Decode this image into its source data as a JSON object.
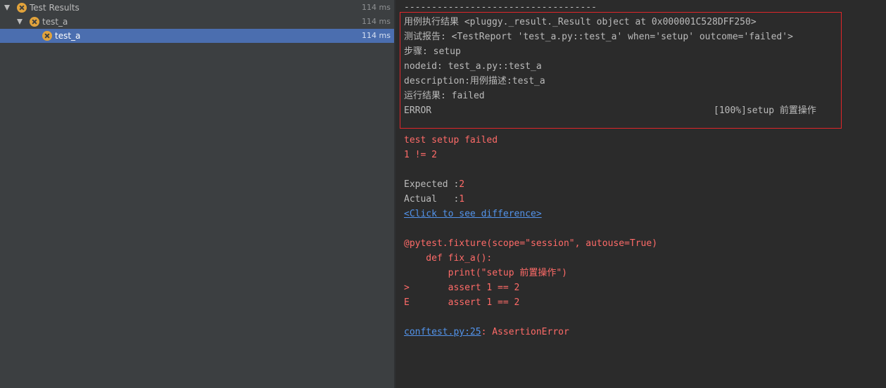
{
  "tree": [
    {
      "label": "Test Results",
      "time": "114 ms",
      "level": 0
    },
    {
      "label": "test_a",
      "time": "114 ms",
      "level": 1
    },
    {
      "label": "test_a",
      "time": "114 ms",
      "level": 2,
      "selected": true
    }
  ],
  "console": {
    "separator": "-----------------------------------",
    "report_lines": [
      "用例执行结果 <pluggy._result._Result object at 0x000001C528DFF250>",
      "测试报告: <TestReport 'test_a.py::test_a' when='setup' outcome='failed'>",
      "步骤: setup",
      "nodeid: test_a.py::test_a",
      "description:用例描述:test_a",
      "运行结果: failed"
    ],
    "error_label": "ERROR",
    "error_suffix": "[100%]setup 前置操作",
    "failure_title": "test setup failed",
    "compare": "1 != 2",
    "expected_label": "Expected :",
    "expected_value": "2",
    "actual_label": "Actual   :",
    "actual_value": "1",
    "diff_link": "<Click to see difference>",
    "code_lines": [
      "@pytest.fixture(scope=\"session\", autouse=True)",
      "    def fix_a():",
      "        print(\"setup 前置操作\")",
      ">       assert 1 == 2",
      "E       assert 1 == 2"
    ],
    "location_link": "conftest.py:25",
    "location_suffix": ": AssertionError"
  },
  "colors": {
    "error_text": "#ff6b68",
    "link": "#5394ec",
    "highlight_border": "#e0262a",
    "fail_icon": "#e2a33b"
  }
}
